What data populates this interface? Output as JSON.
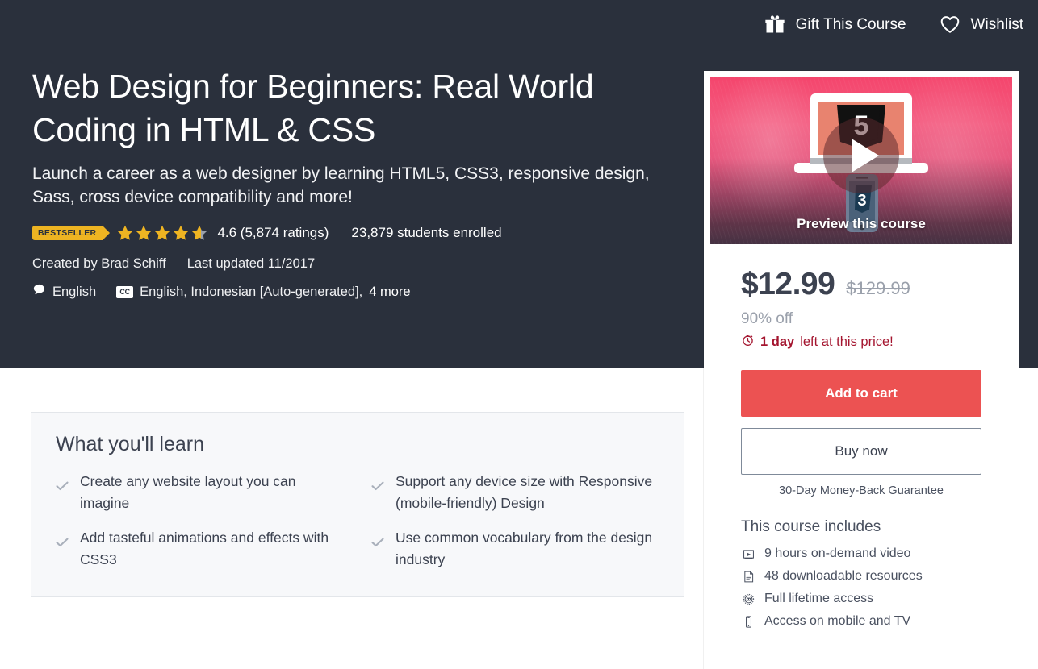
{
  "header": {
    "gift_label": "Gift This Course",
    "gift_icon": "gift-icon",
    "wishlist_label": "Wishlist",
    "wishlist_icon": "heart-icon"
  },
  "hero": {
    "title": "Web Design for Beginners: Real World Coding in HTML & CSS",
    "subtitle": "Launch a career as a web designer by learning HTML5, CSS3, responsive design, Sass, cross device compatibility and more!",
    "badge": "BESTSELLER",
    "rating_value": 4.6,
    "rating_stars_filled": 4.6,
    "rating_text": "4.6 (5,874 ratings)",
    "ratings_count": "5,874",
    "students_enrolled": "23,879 students enrolled",
    "created_by": "Created by Brad Schiff",
    "last_updated": "Last updated 11/2017",
    "spoken_language": "English",
    "spoken_language_icon": "speech-bubble-icon",
    "caption_badge": "CC",
    "captions": "English, Indonesian [Auto-generated],",
    "captions_more": "4 more",
    "bg_color": "#2a303c"
  },
  "buybox": {
    "preview_label": "Preview this course",
    "preview_icon": "play-icon",
    "price_current": "$12.99",
    "price_original": "$129.99",
    "discount": "90% off",
    "urgency_icon": "timer-icon",
    "urgency_strong": "1 day",
    "urgency_rest": "left at this price!",
    "add_to_cart_label": "Add to cart",
    "buy_now_label": "Buy now",
    "guarantee": "30-Day Money-Back Guarantee",
    "includes_title": "This course includes",
    "includes": [
      {
        "icon": "video-icon",
        "label": "9 hours on-demand video"
      },
      {
        "icon": "document-icon",
        "label": "48 downloadable resources"
      },
      {
        "icon": "infinity-icon",
        "label": "Full lifetime access"
      },
      {
        "icon": "mobile-icon",
        "label": "Access on mobile and TV"
      }
    ],
    "accent_color": "#ec5252",
    "urgency_color": "#a4152f"
  },
  "learn": {
    "title": "What you'll learn",
    "items": [
      "Create any website layout you can imagine",
      "Support any device size with Responsive (mobile-friendly) Design",
      "Add tasteful animations and effects with CSS3",
      "Use common vocabulary from the design industry"
    ]
  }
}
